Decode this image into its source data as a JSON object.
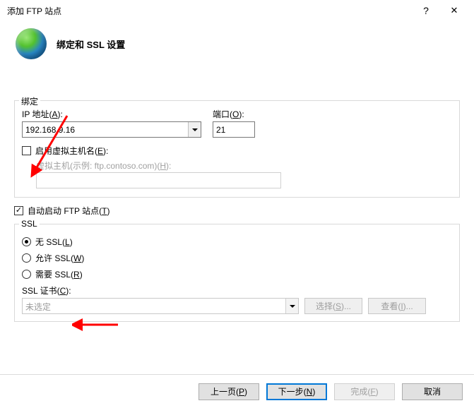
{
  "window": {
    "title": "添加 FTP 站点",
    "help_glyph": "?",
    "close_glyph": "✕"
  },
  "header": {
    "title": "绑定和 SSL 设置"
  },
  "binding": {
    "legend": "绑定",
    "ip_label_prefix": "IP 地址(",
    "ip_label_key": "A",
    "ip_label_suffix": "):",
    "ip_value": "192.168.9.16",
    "port_label_prefix": "端口(",
    "port_label_key": "O",
    "port_label_suffix": "):",
    "port_value": "21",
    "enable_vhost_prefix": "启用虚拟主机名(",
    "enable_vhost_key": "E",
    "enable_vhost_suffix": "):",
    "enable_vhost_checked": false,
    "vhost_hint_prefix": "虚拟主机(示例: ftp.contoso.com)(",
    "vhost_hint_key": "H",
    "vhost_hint_suffix": "):",
    "vhost_value": ""
  },
  "autostart": {
    "label_prefix": "自动启动 FTP 站点(",
    "label_key": "T",
    "label_suffix": ")",
    "checked": true
  },
  "ssl": {
    "legend": "SSL",
    "no_ssl_prefix": "无 SSL(",
    "no_ssl_key": "L",
    "no_ssl_suffix": ")",
    "allow_ssl_prefix": "允许 SSL(",
    "allow_ssl_key": "W",
    "allow_ssl_suffix": ")",
    "require_ssl_prefix": "需要 SSL(",
    "require_ssl_key": "R",
    "require_ssl_suffix": ")",
    "selected": "no",
    "cert_label_prefix": "SSL 证书(",
    "cert_label_key": "C",
    "cert_label_suffix": "):",
    "cert_value": "未选定",
    "select_btn_prefix": "选择(",
    "select_btn_key": "S",
    "select_btn_suffix": ")...",
    "view_btn_prefix": "查看(",
    "view_btn_key": "I",
    "view_btn_suffix": ")..."
  },
  "footer": {
    "prev_prefix": "上一页(",
    "prev_key": "P",
    "prev_suffix": ")",
    "next_prefix": "下一步(",
    "next_key": "N",
    "next_suffix": ")",
    "finish_prefix": "完成(",
    "finish_key": "F",
    "finish_suffix": ")",
    "cancel": "取消"
  }
}
